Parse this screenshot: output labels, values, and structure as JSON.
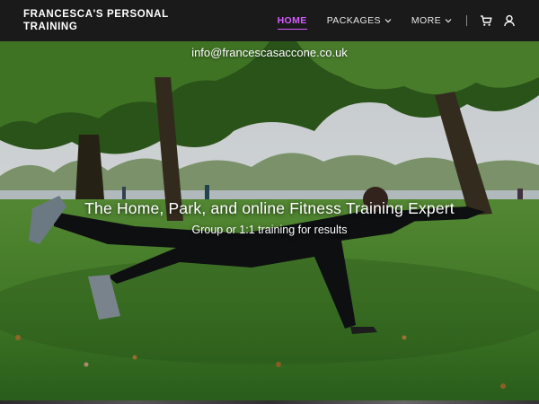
{
  "brand": {
    "line1": "FRANCESCA'S PERSONAL",
    "line2": "TRAINING"
  },
  "nav": {
    "items": [
      {
        "label": "HOME",
        "active": true,
        "dropdown": false
      },
      {
        "label": "PACKAGES",
        "active": false,
        "dropdown": true
      },
      {
        "label": "MORE",
        "active": false,
        "dropdown": true
      }
    ],
    "icons": [
      "cart-icon",
      "user-icon"
    ],
    "active_color": "#d65cff"
  },
  "hero": {
    "email": "info@francescasaccone.co.uk",
    "headline": "The Home, Park, and online Fitness Training Expert",
    "subheadline": "Group or 1:1 training for results"
  }
}
